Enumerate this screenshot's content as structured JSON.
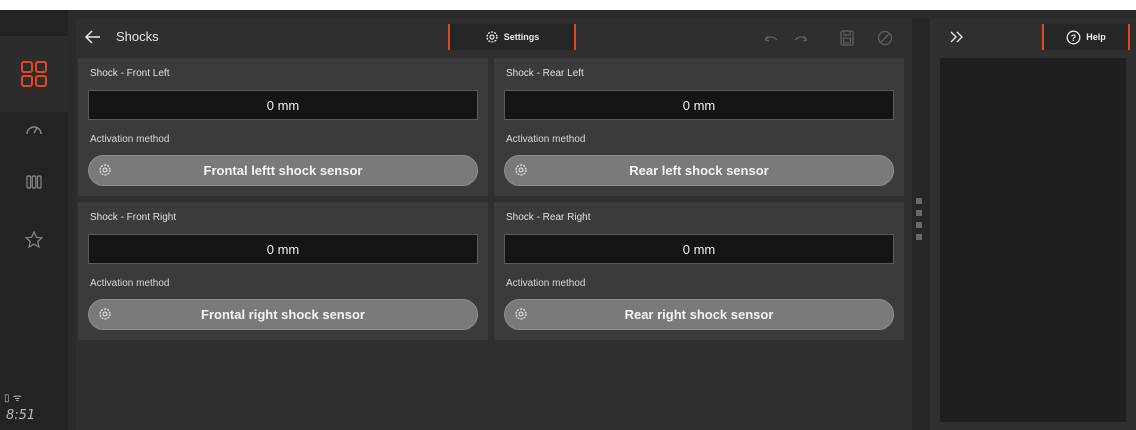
{
  "status": {
    "time": "8:51",
    "icons": [
      "battery-icon",
      "wifi-icon"
    ]
  },
  "nav": {
    "items": [
      "grid-apps-icon",
      "dashboard-gauge-icon",
      "columns-icon",
      "star-icon"
    ]
  },
  "header": {
    "title": "Shocks",
    "settings_label": "Settings"
  },
  "toolbar": {
    "icons": [
      "undo-icon",
      "redo-icon",
      "save-icon",
      "cancel-icon"
    ]
  },
  "cards": [
    {
      "title": "Shock - Front Left",
      "value": "0 mm",
      "activation_label": "Activation method",
      "sensor": "Frontal leftt shock sensor"
    },
    {
      "title": "Shock - Rear Left",
      "value": "0 mm",
      "activation_label": "Activation method",
      "sensor": "Rear left shock sensor"
    },
    {
      "title": "Shock - Front Right",
      "value": "0 mm",
      "activation_label": "Activation method",
      "sensor": "Frontal right shock sensor"
    },
    {
      "title": "Shock - Rear Right",
      "value": "0 mm",
      "activation_label": "Activation method",
      "sensor": "Rear right shock sensor"
    }
  ],
  "help": {
    "label": "Help"
  },
  "colors": {
    "accent": "#e2471f",
    "background": "#2f2f2f",
    "card": "#3b3b3b",
    "button": "#7a7a7a"
  }
}
